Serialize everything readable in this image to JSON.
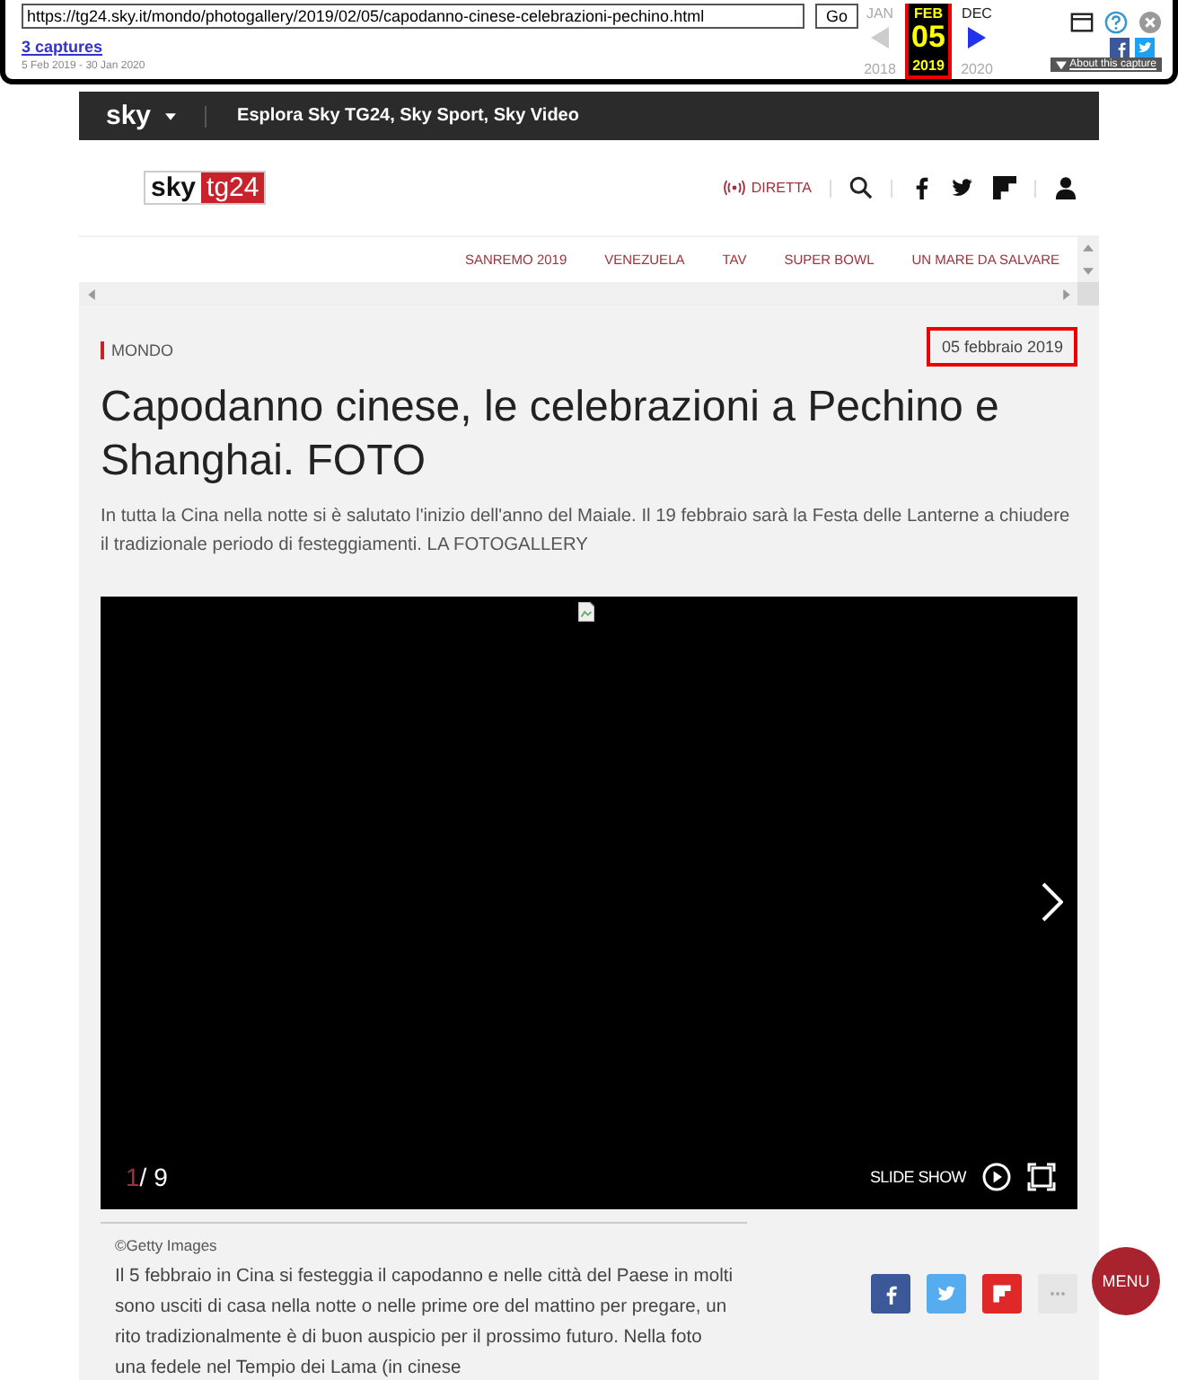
{
  "wayback": {
    "url": "https://tg24.sky.it/mondo/photogallery/2019/02/05/capodanno-cinese-celebrazioni-pechino.html",
    "go": "Go",
    "captures": "3 captures",
    "range": "5 Feb 2019 - 30 Jan 2020",
    "calendar": [
      {
        "month": "JAN",
        "year": "2018",
        "selected": false
      },
      {
        "month": "FEB",
        "day": "05",
        "year": "2019",
        "selected": true
      },
      {
        "month": "DEC",
        "year": "2020",
        "selected": false
      }
    ],
    "about": "About this capture"
  },
  "site_bar": {
    "brand": "sky",
    "explore": "Esplora Sky TG24, Sky Sport, Sky Video"
  },
  "header": {
    "logo": [
      "sky",
      "tg24"
    ],
    "live": "DIRETTA"
  },
  "topics": [
    "SANREMO 2019",
    "VENEZUELA",
    "TAV",
    "SUPER BOWL",
    "UN MARE DA SALVARE"
  ],
  "article": {
    "category": "MONDO",
    "date": "05 febbraio 2019",
    "title": "Capodanno cinese, le celebrazioni a Pechino e Shanghai. FOTO",
    "summary": "In tutta la Cina nella notte si è salutato l'inizio dell'anno del Maiale. Il 19 febbraio sarà la Festa delle Lanterne a chiudere il tradizionale periodo di festeggiamenti. LA FOTOGALLERY"
  },
  "gallery": {
    "current": "1",
    "total": "/ 9",
    "slideshow": "SLIDE SHOW",
    "credit": "©Getty Images",
    "caption": "Il 5 febbraio in Cina si festeggia il capodanno e nelle città del Paese in molti sono usciti di casa nella notte o nelle prime ore del mattino per pregare, un rito tradizionalmente è di buon auspicio per il prossimo futuro. Nella foto una fedele nel Tempio dei Lama (in cinese"
  },
  "share": [
    {
      "kind": "facebook",
      "color": "#3b5998"
    },
    {
      "kind": "twitter",
      "color": "#55acee"
    },
    {
      "kind": "flipboard",
      "color": "#e12828"
    },
    {
      "kind": "more",
      "color": "#e6e6e6"
    }
  ],
  "menu": "MENU"
}
